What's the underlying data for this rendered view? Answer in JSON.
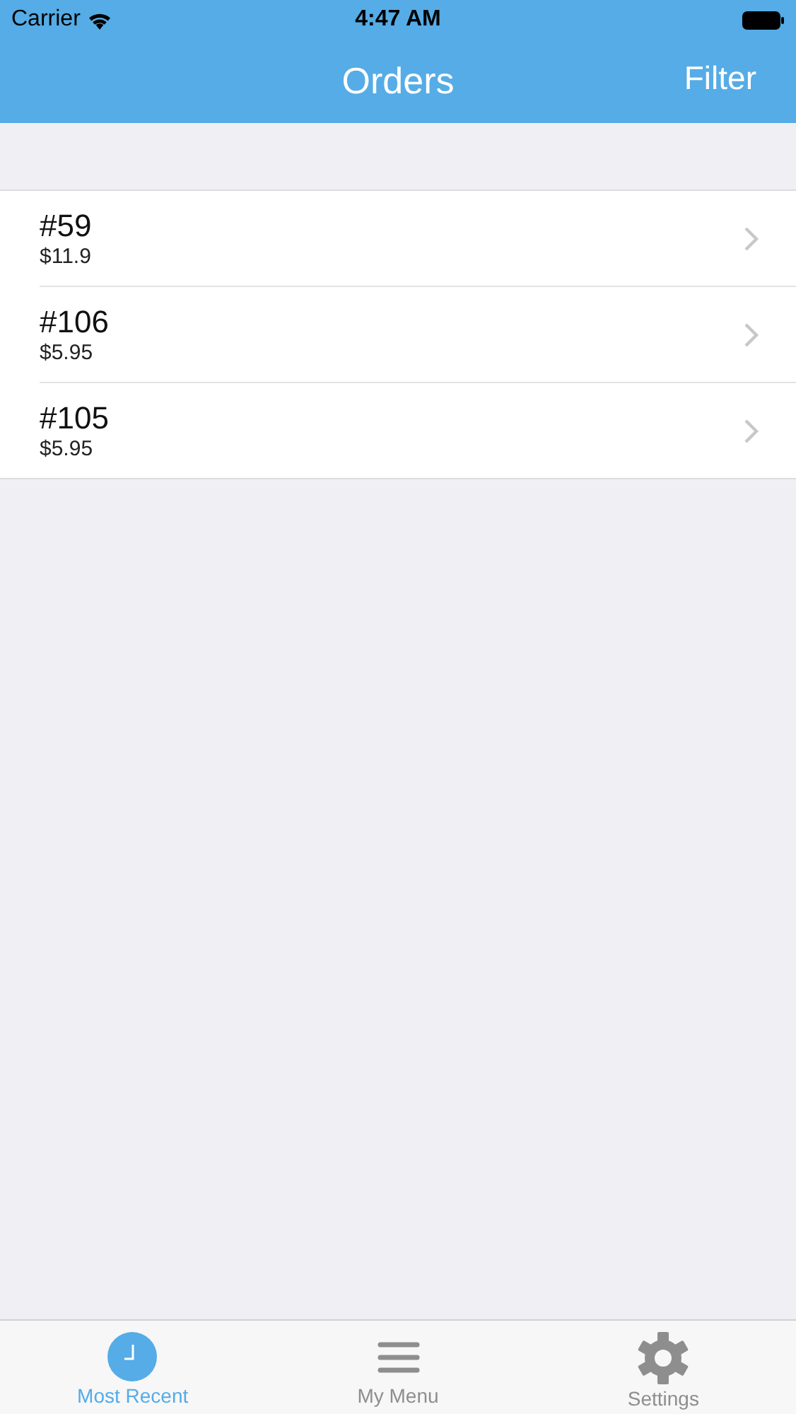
{
  "status_bar": {
    "carrier": "Carrier",
    "time": "4:47 AM"
  },
  "nav_bar": {
    "title": "Orders",
    "right_button": "Filter"
  },
  "orders": [
    {
      "number": "#59",
      "price": "$11.9"
    },
    {
      "number": "#106",
      "price": "$5.95"
    },
    {
      "number": "#105",
      "price": "$5.95"
    }
  ],
  "tab_bar": [
    {
      "kind": "clock",
      "label": "Most Recent",
      "selected": true
    },
    {
      "kind": "menu",
      "label": "My Menu",
      "selected": false
    },
    {
      "kind": "gear",
      "label": "Settings",
      "selected": false
    }
  ]
}
